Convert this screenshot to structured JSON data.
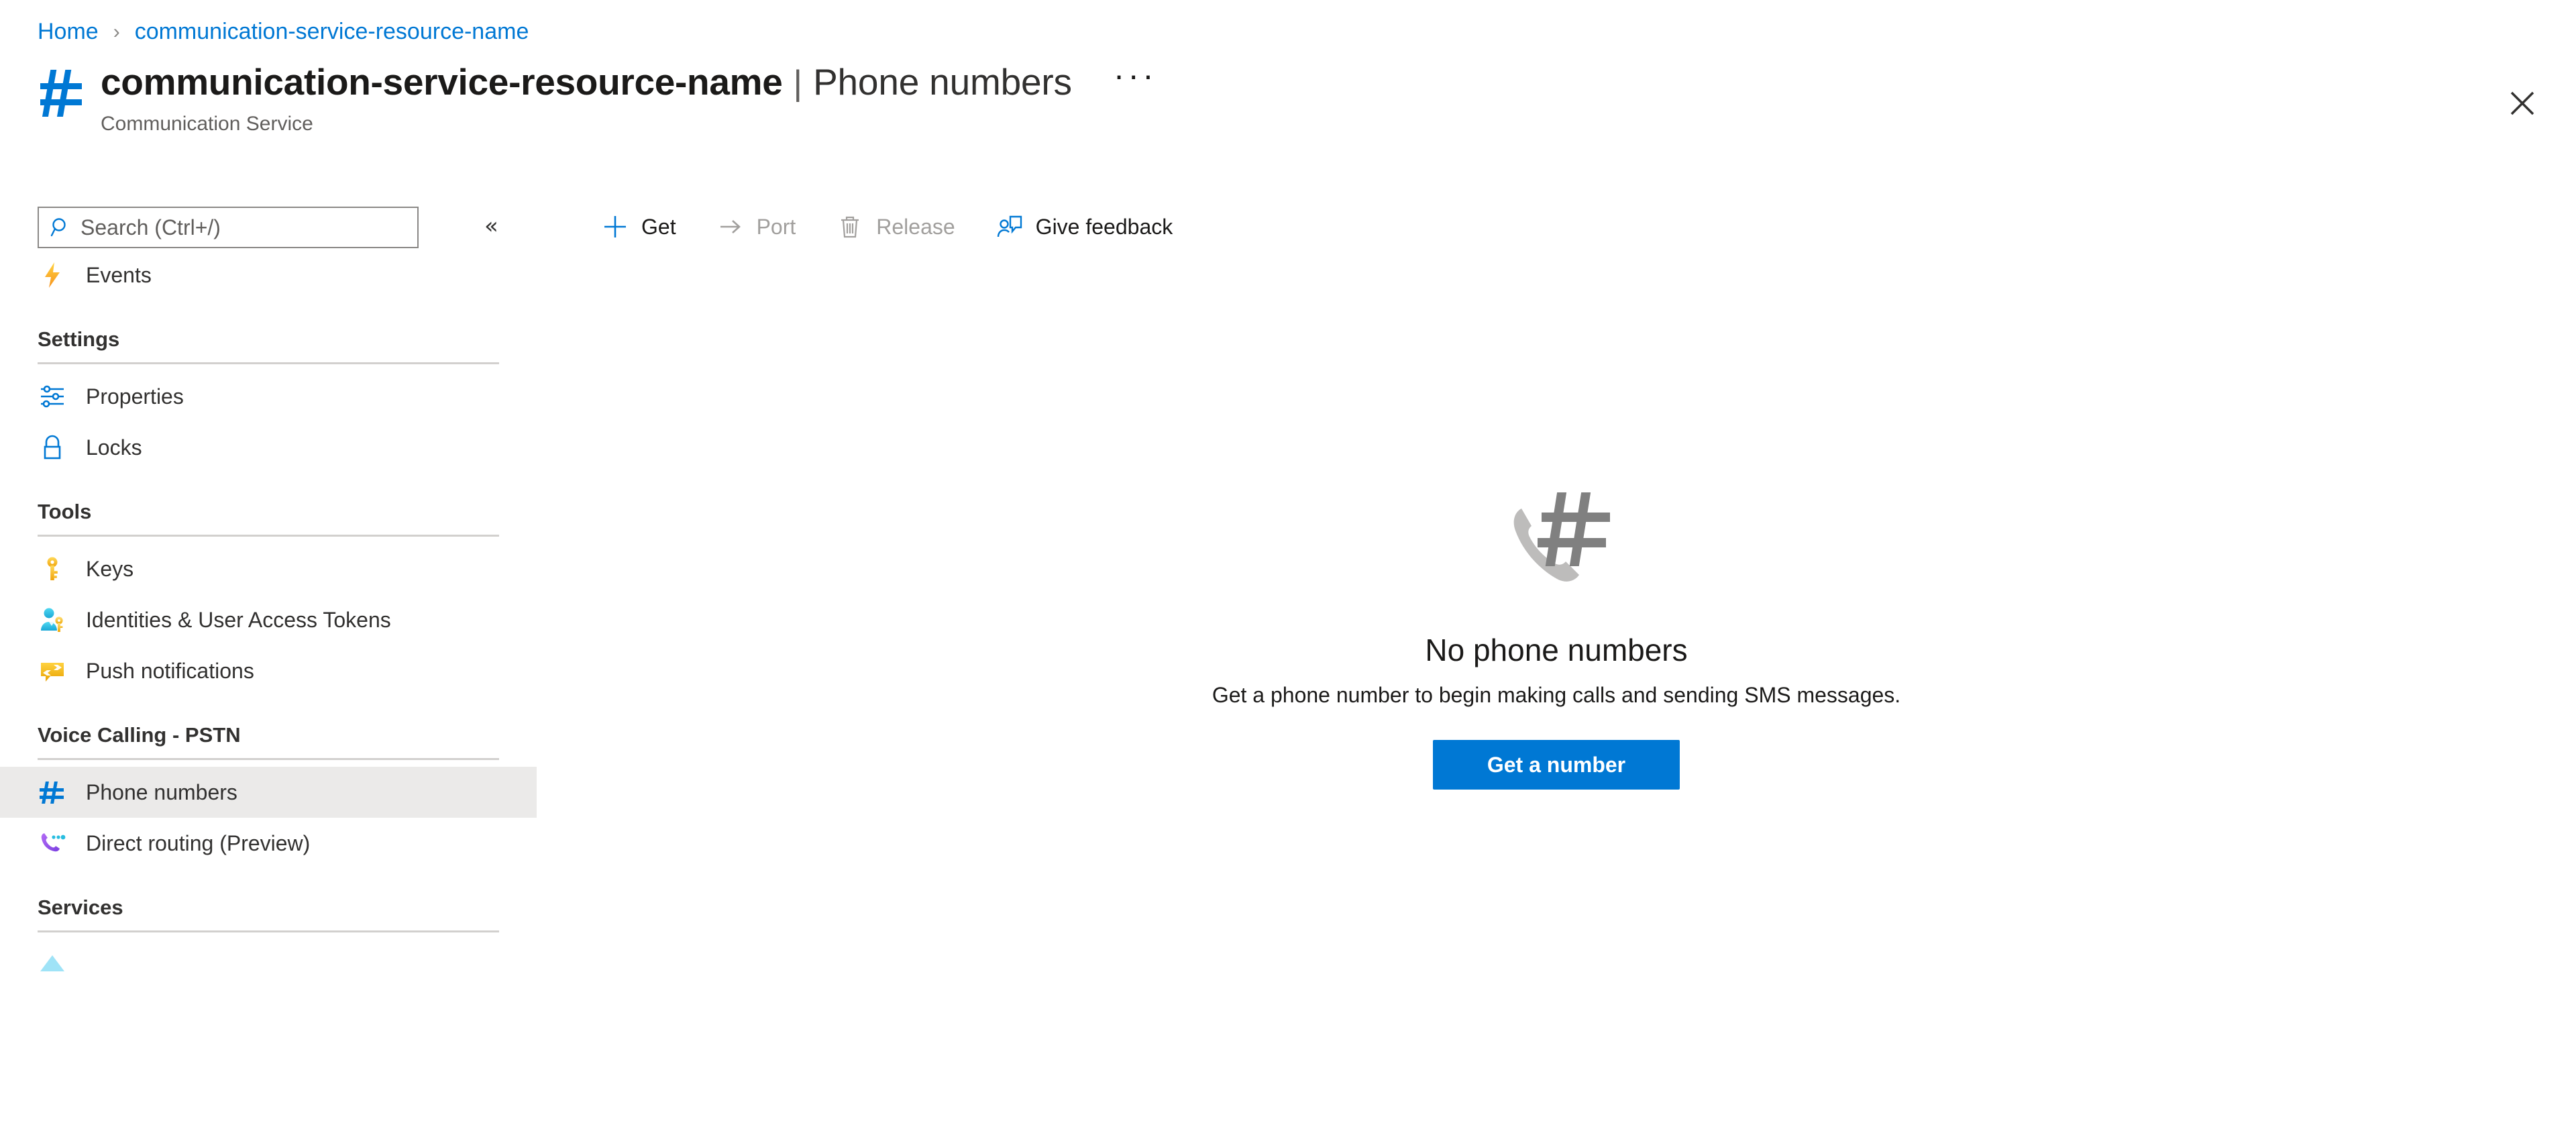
{
  "breadcrumb": {
    "home_label": "Home",
    "separator": "›",
    "resource_label": "communication-service-resource-name"
  },
  "header": {
    "icon": "hash-icon",
    "resource_name": "communication-service-resource-name",
    "divider": "|",
    "blade_name": "Phone numbers",
    "ellipsis": "···",
    "caption": "Communication Service",
    "close_icon": "close-icon"
  },
  "sidebar": {
    "search": {
      "icon": "search-icon",
      "placeholder": "Search (Ctrl+/)",
      "value": ""
    },
    "collapse": {
      "icon": "chevron-double-left-icon",
      "glyph": "«"
    },
    "top_items": [
      {
        "label": "Events",
        "icon": "events-lightning-icon"
      }
    ],
    "groups": [
      {
        "title": "Settings",
        "items": [
          {
            "label": "Properties",
            "icon": "properties-sliders-icon",
            "selected": false
          },
          {
            "label": "Locks",
            "icon": "lock-icon",
            "selected": false
          }
        ]
      },
      {
        "title": "Tools",
        "items": [
          {
            "label": "Keys",
            "icon": "key-icon",
            "selected": false
          },
          {
            "label": "Identities & User Access Tokens",
            "icon": "user-key-icon",
            "selected": false
          },
          {
            "label": "Push notifications",
            "icon": "push-notification-icon",
            "selected": false
          }
        ]
      },
      {
        "title": "Voice Calling - PSTN",
        "items": [
          {
            "label": "Phone numbers",
            "icon": "hash-icon",
            "selected": true
          },
          {
            "label": "Direct routing (Preview)",
            "icon": "direct-routing-phone-icon",
            "selected": false
          }
        ]
      },
      {
        "title": "Services",
        "items": []
      }
    ]
  },
  "command_bar": {
    "commands": [
      {
        "label": "Get",
        "icon": "plus-icon",
        "enabled": true
      },
      {
        "label": "Port",
        "icon": "arrow-right-icon",
        "enabled": false
      },
      {
        "label": "Release",
        "icon": "trash-icon",
        "enabled": false
      },
      {
        "label": "Give feedback",
        "icon": "feedback-person-icon",
        "enabled": true
      }
    ]
  },
  "empty_state": {
    "illustration": "phone-hash-icon",
    "title": "No phone numbers",
    "description": "Get a phone number to begin making calls and sending SMS messages.",
    "button_label": "Get a number"
  },
  "colors": {
    "accent_blue": "#0078d4",
    "text_primary": "#1b1a19",
    "text_secondary": "#605e5c",
    "text_disabled": "#a19f9d",
    "selected_row": "#ebeae9",
    "rule": "#d2d0ce",
    "illustration_grey": "#b3b2b0",
    "illustration_dark_grey": "#808080"
  }
}
